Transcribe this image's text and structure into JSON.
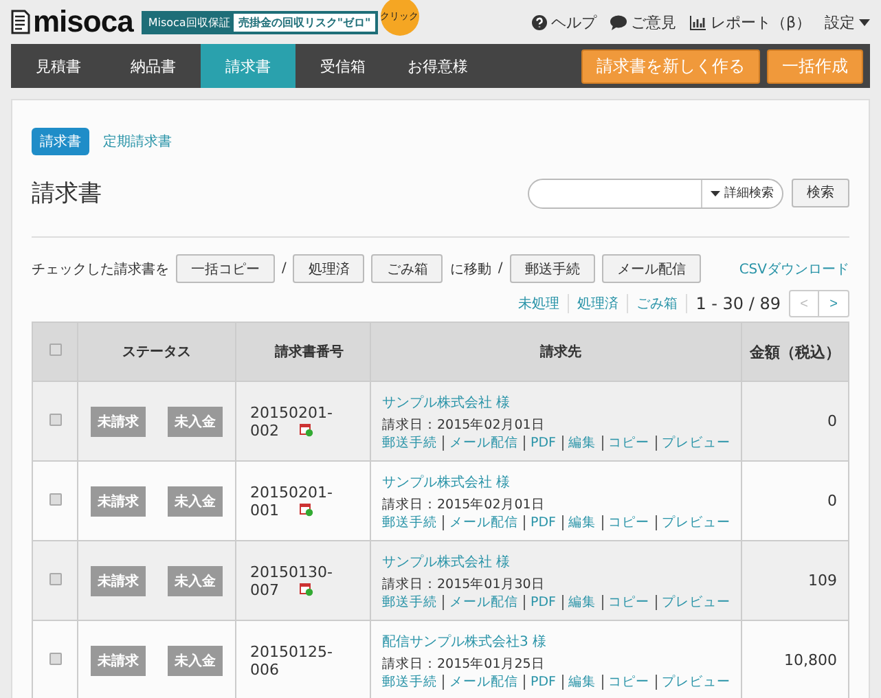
{
  "header": {
    "logo": "misoca",
    "banner": {
      "label": "Misoca回収保証",
      "text": "売掛金の回収リスク\"ゼロ\"",
      "badge": "クリック"
    },
    "links": [
      {
        "label": "ヘルプ",
        "kind": "help"
      },
      {
        "label": "ご意見",
        "kind": "comment"
      },
      {
        "label": "レポート（β）",
        "kind": "report"
      },
      {
        "label": "設定",
        "kind": "menu"
      }
    ]
  },
  "nav": {
    "tabs": [
      {
        "label": "見積書",
        "selected": false
      },
      {
        "label": "納品書",
        "selected": false
      },
      {
        "label": "請求書",
        "selected": true
      },
      {
        "label": "受信箱",
        "selected": false
      },
      {
        "label": "お得意様",
        "selected": false
      }
    ],
    "actions": [
      "請求書を新しく作る",
      "一括作成"
    ]
  },
  "subtabs": [
    {
      "label": "請求書",
      "selected": true
    },
    {
      "label": "定期請求書",
      "selected": false
    }
  ],
  "title": "請求書",
  "search": {
    "dropdown": "詳細検索",
    "button": "検索"
  },
  "bulk": {
    "prefix": "チェックした請求書を",
    "copy": "一括コピー",
    "sep1": "/",
    "move": [
      "処理済",
      "ごみ箱"
    ],
    "move_label": "に移動",
    "sep2": "/",
    "send": [
      "郵送手続",
      "メール配信"
    ],
    "csv": "CSVダウンロード"
  },
  "filters": [
    "未処理",
    "処理済",
    "ごみ箱"
  ],
  "pagination": {
    "range": "1 - 30 / 89",
    "prev": "<",
    "next": ">"
  },
  "table": {
    "select_all_checked": false,
    "columns": [
      "ステータス",
      "請求書番号",
      "請求先",
      "金額（税込）"
    ],
    "rows": [
      {
        "checked": false,
        "status": [
          "未請求",
          "未入金"
        ],
        "number": "20150201-002",
        "recurring": true,
        "client": "サンプル株式会社 様",
        "date": "請求日：2015年02月01日",
        "actions": [
          "郵送手続",
          "メール配信",
          "PDF",
          "編集",
          "コピー",
          "プレビュー"
        ],
        "amount": "0"
      },
      {
        "checked": false,
        "status": [
          "未請求",
          "未入金"
        ],
        "number": "20150201-001",
        "recurring": true,
        "client": "サンプル株式会社 様",
        "date": "請求日：2015年02月01日",
        "actions": [
          "郵送手続",
          "メール配信",
          "PDF",
          "編集",
          "コピー",
          "プレビュー"
        ],
        "amount": "0"
      },
      {
        "checked": false,
        "status": [
          "未請求",
          "未入金"
        ],
        "number": "20150130-007",
        "recurring": true,
        "client": "サンプル株式会社 様",
        "date": "請求日：2015年01月30日",
        "actions": [
          "郵送手続",
          "メール配信",
          "PDF",
          "編集",
          "コピー",
          "プレビュー"
        ],
        "amount": "109"
      },
      {
        "checked": false,
        "status": [
          "未請求",
          "未入金"
        ],
        "number": "20150125-006",
        "recurring": false,
        "client": "配信サンプル株式会社3 様",
        "date": "請求日：2015年01月25日",
        "actions": [
          "郵送手続",
          "メール配信",
          "PDF",
          "編集",
          "コピー",
          "プレビュー"
        ],
        "amount": "10,800"
      }
    ]
  }
}
